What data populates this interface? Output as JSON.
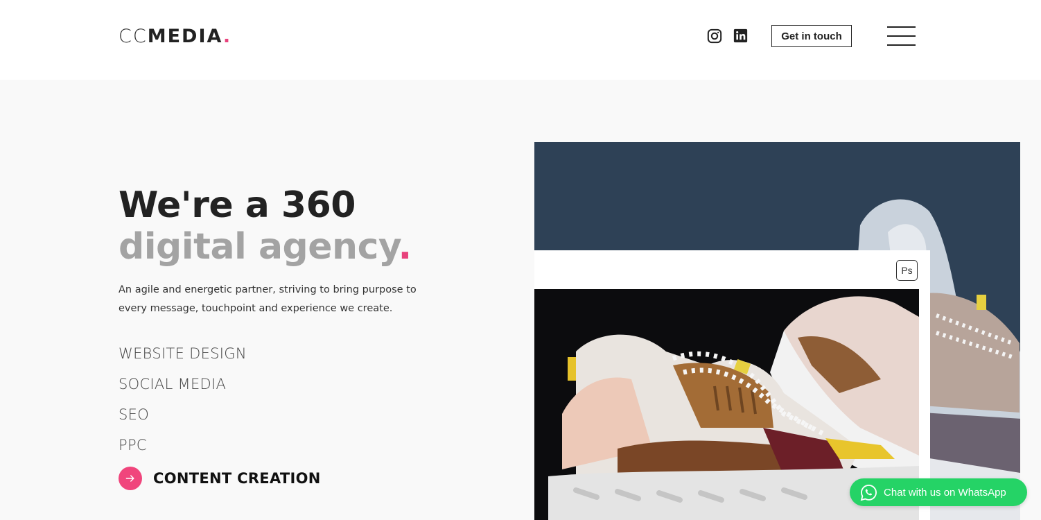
{
  "header": {
    "logo": {
      "part1": "CC",
      "part2": "MEDIA",
      "dot": "."
    },
    "social": [
      {
        "name": "instagram-icon"
      },
      {
        "name": "linkedin-icon"
      }
    ],
    "cta_label": "Get in touch",
    "menu_icon": "hamburger-menu-icon"
  },
  "hero": {
    "title_line1": "We're a 360",
    "title_line2": "digital agency",
    "title_dot": ".",
    "tagline": "An agile and energetic partner, striving to bring purpose to every message, touchpoint and experience we create.",
    "services": [
      {
        "label": "WEBSITE DESIGN"
      },
      {
        "label": "SOCIAL MEDIA"
      },
      {
        "label": "SEO"
      },
      {
        "label": "PPC"
      },
      {
        "label": "CONTENT CREATION",
        "active": true
      }
    ]
  },
  "visual": {
    "badge": "Ps",
    "background_color": "#2e4156"
  },
  "whatsapp": {
    "label": "Chat with us on WhatsApp",
    "icon": "whatsapp-icon",
    "color": "#25d366"
  },
  "colors": {
    "accent": "#e8427c",
    "text_dark": "#222222",
    "text_grey": "#a3a3a3"
  }
}
